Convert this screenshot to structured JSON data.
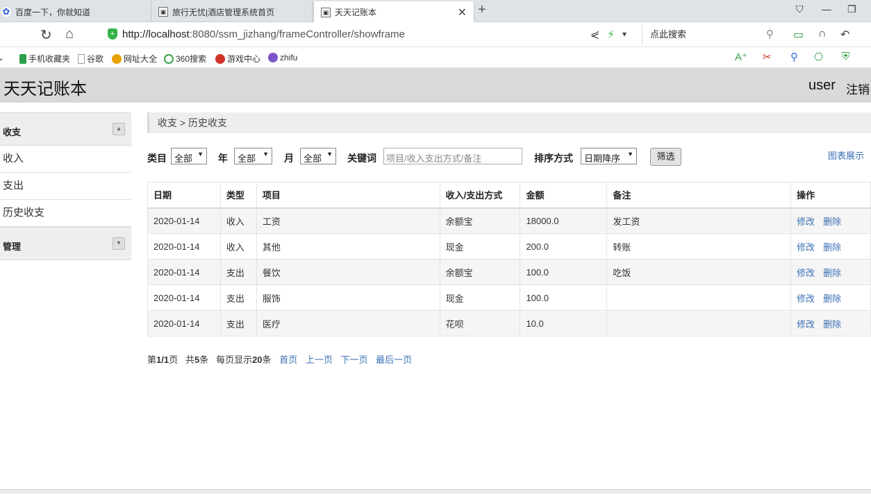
{
  "browser": {
    "tabs": [
      {
        "title": "百度一下，你就知道",
        "active": false
      },
      {
        "title": "旅行无忧|酒店管理系统首页",
        "active": false
      },
      {
        "title": "天天记账本",
        "active": true
      }
    ],
    "url_scheme_host": "http://localhost",
    "url_rest": ":8080/ssm_jizhang/frameController/showframe",
    "search_placeholder": "点此搜索",
    "bookmarks": [
      "手机收藏夹",
      "谷歌",
      "网址大全",
      "360搜索",
      "游戏中心",
      "zhifu"
    ]
  },
  "header": {
    "app_title": "天天记账本",
    "user": "user",
    "logout": "注销"
  },
  "sidebar": {
    "groups": [
      {
        "label": "收支",
        "items": [
          "收入",
          "支出",
          "历史收支"
        ]
      },
      {
        "label": "管理",
        "items": []
      }
    ]
  },
  "breadcrumb": "收支 > 历史收支",
  "filters": {
    "category_label": "类目",
    "category_value": "全部",
    "year_label": "年",
    "year_value": "全部",
    "month_label": "月",
    "month_value": "全部",
    "keyword_label": "关键词",
    "keyword_placeholder": "项目/收入支出方式/备注",
    "sort_label": "排序方式",
    "sort_value": "日期降序",
    "filter_button": "筛选",
    "chart_link": "图表展示"
  },
  "table": {
    "columns": [
      "日期",
      "类型",
      "项目",
      "收入/支出方式",
      "金额",
      "备注",
      "操作"
    ],
    "rows": [
      {
        "date": "2020-01-14",
        "type": "收入",
        "item": "工资",
        "method": "余额宝",
        "amount": "18000.0",
        "note": "发工资"
      },
      {
        "date": "2020-01-14",
        "type": "收入",
        "item": "其他",
        "method": "现金",
        "amount": "200.0",
        "note": "转账"
      },
      {
        "date": "2020-01-14",
        "type": "支出",
        "item": "餐饮",
        "method": "余额宝",
        "amount": "100.0",
        "note": "吃饭"
      },
      {
        "date": "2020-01-14",
        "type": "支出",
        "item": "服饰",
        "method": "现金",
        "amount": "100.0",
        "note": ""
      },
      {
        "date": "2020-01-14",
        "type": "支出",
        "item": "医疗",
        "method": "花呗",
        "amount": "10.0",
        "note": ""
      }
    ],
    "edit_label": "修改",
    "delete_label": "删除"
  },
  "pager": {
    "page_prefix": "第",
    "page_value": "1/1",
    "page_suffix": "页",
    "total_prefix": "共",
    "total_value": "5",
    "total_suffix": "条",
    "per_prefix": "每页显示",
    "per_value": "20",
    "per_suffix": "条",
    "first": "首页",
    "prev": "上一页",
    "next": "下一页",
    "last": "最后一页"
  }
}
